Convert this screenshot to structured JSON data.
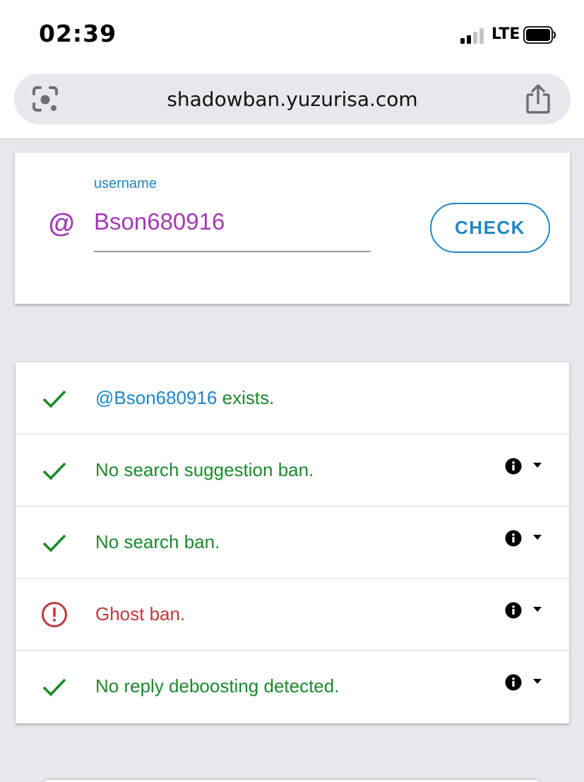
{
  "status_bar": {
    "time": "02:39",
    "network": "LTE",
    "signal_bars_active": 2,
    "signal_bars_total": 4,
    "battery_level": 0.9
  },
  "browser": {
    "url": "shadowban.yuzurisa.com",
    "left_icon": "lens-icon",
    "right_icon": "share-icon"
  },
  "form": {
    "label": "username",
    "prefix": "@",
    "value": "Bson680916",
    "button": "CHECK"
  },
  "results": [
    {
      "status": "ok",
      "user": "@Bson680916",
      "text": " exists.",
      "icon": "check-icon",
      "has_info": false
    },
    {
      "status": "ok",
      "text": "No search suggestion ban.",
      "icon": "check-icon",
      "has_info": true
    },
    {
      "status": "ok",
      "text": "No search ban.",
      "icon": "check-icon",
      "has_info": true
    },
    {
      "status": "bad",
      "text": "Ghost ban.",
      "icon": "alert-circle-icon",
      "has_info": true
    },
    {
      "status": "ok",
      "text": "No reply deboosting detected.",
      "icon": "check-icon",
      "has_info": true
    }
  ],
  "colors": {
    "accent_blue": "#1e86c4",
    "username_purple": "#a33ab5",
    "ok_green": "#1a8a2b",
    "bad_red": "#c0393b",
    "page_bg": "#e5e9ee"
  }
}
